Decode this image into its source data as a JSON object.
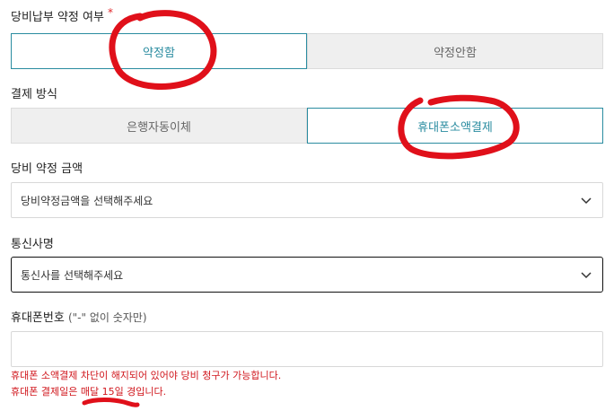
{
  "fields": {
    "agreement": {
      "label": "당비납부 약정 여부",
      "required_mark": "*",
      "options": [
        "약정함",
        "약정안함"
      ],
      "selected": "약정함"
    },
    "payment_method": {
      "label": "결제 방식",
      "options": [
        "은행자동이체",
        "휴대폰소액결제"
      ],
      "selected": "휴대폰소액결제"
    },
    "amount": {
      "label": "당비 약정 금액",
      "value": "당비약정금액을 선택해주세요"
    },
    "carrier": {
      "label": "통신사명",
      "value": "통신사를 선택해주세요"
    },
    "phone": {
      "label": "휴대폰번호",
      "hint": "(\"-\" 없이 숫자만)",
      "value": "",
      "placeholder": ""
    }
  },
  "notes": [
    "휴대폰 소액결제 차단이 해지되어 있어야 당비 청구가 가능합니다.",
    "휴대폰 결제일은 매달 15일 경입니다."
  ],
  "colors": {
    "accent": "#2a8ca0",
    "notice_red": "#d0161c",
    "annotation_red": "#e0101a",
    "inactive_bg": "#efefef"
  }
}
